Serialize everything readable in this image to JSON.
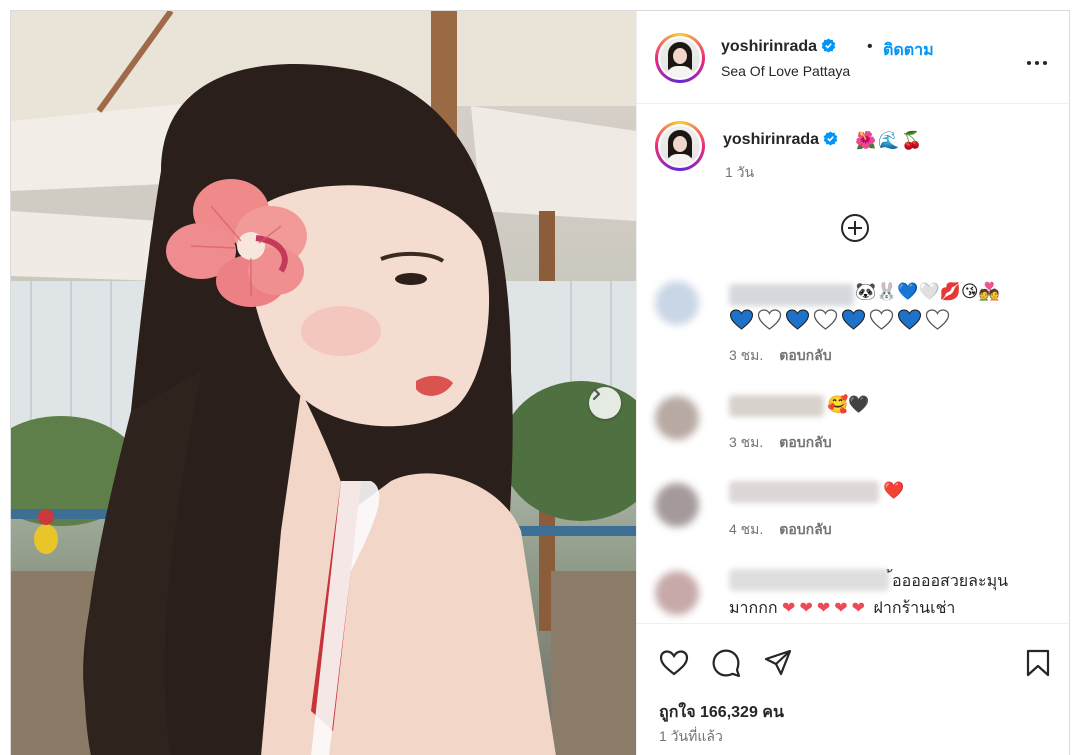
{
  "post": {
    "username": "yoshirinrada",
    "dot": "•",
    "follow_label": "ติดตาม",
    "location": "Sea Of Love Pattaya"
  },
  "caption": {
    "username": "yoshirinrada",
    "emojis": "🌺🌊🍒",
    "time": "1 วัน"
  },
  "comments": [
    {
      "text": "🐼🐰💙🤍💋😘💑",
      "hearts": [
        "blue",
        "white",
        "blue",
        "white",
        "blue",
        "white",
        "blue",
        "white"
      ],
      "time": "3 ชม.",
      "reply": "ตอบกลับ"
    },
    {
      "text": "🥰🖤",
      "time": "3 ชม.",
      "reply": "ตอบกลับ"
    },
    {
      "text": "❤️",
      "time": "4 ชม.",
      "reply": "ตอบกลับ"
    },
    {
      "line1": "้อออออสวยละมุน",
      "line2_prefix": "มากกก",
      "line2_suffix": "ฝากร้านเช่า"
    }
  ],
  "footer": {
    "likes": "ถูกใจ 166,329 คน",
    "posted": "1 วันที่แล้ว"
  },
  "icons": [
    "heart-icon",
    "comment-icon",
    "share-icon",
    "save-icon",
    "more-icon",
    "plus-circle-icon",
    "chevron-right-icon",
    "verified-icon"
  ],
  "colors": {
    "accent": "#0095f6",
    "text": "#262626",
    "muted": "#737373",
    "verified": "#0095f6",
    "heart_red": "#ed4956",
    "heart_blue": "#1f72c9"
  }
}
